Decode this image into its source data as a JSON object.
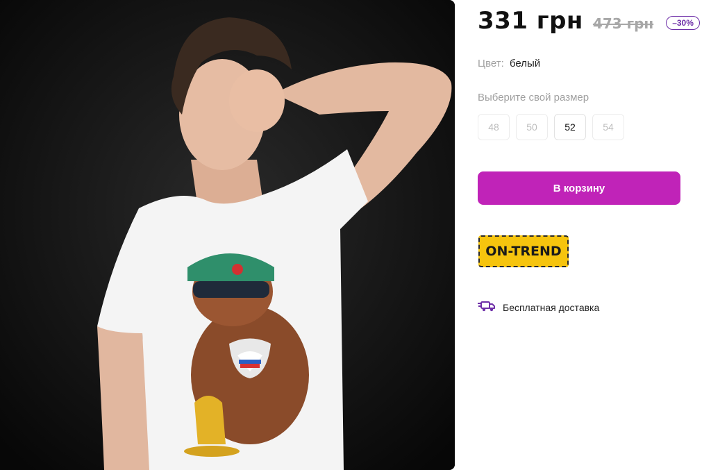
{
  "product": {
    "price_current": "331 грн",
    "price_old": "473 грн",
    "discount": "–30%",
    "color_label": "Цвет:",
    "color_value": "белый",
    "size_label": "Выберите свой размер",
    "sizes": [
      {
        "label": "48",
        "selected": false
      },
      {
        "label": "50",
        "selected": false
      },
      {
        "label": "52",
        "selected": true
      },
      {
        "label": "54",
        "selected": false
      }
    ],
    "cart_button": "В корзину",
    "trend_badge": "ON-TREND",
    "delivery_text": "Бесплатная доставка"
  },
  "colors": {
    "accent": "#c023b8",
    "discount": "#6e2fa8",
    "badge_yellow": "#f6c40e",
    "photo_bg": "#0b0b0b"
  },
  "icons": {
    "delivery": "delivery-truck-icon"
  }
}
